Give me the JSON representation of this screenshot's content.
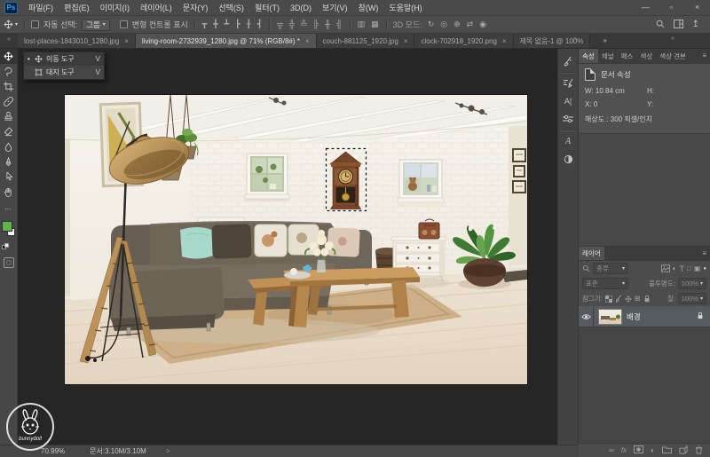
{
  "titlebar": {
    "logo": "Ps",
    "menus": [
      "파일(F)",
      "편집(E)",
      "이미지(I)",
      "레이어(L)",
      "문자(Y)",
      "선택(S)",
      "필터(T)",
      "3D(D)",
      "보기(V)",
      "창(W)",
      "도움말(H)"
    ],
    "window": {
      "minimize": "—",
      "maximize": "▫",
      "close": "×"
    }
  },
  "options_bar": {
    "auto_select_label": "자동 선택:",
    "auto_select_value": "그룹",
    "show_transform_label": "변형 컨트롤 표시",
    "mode_3d_label": "3D 모드:"
  },
  "tab_bar": {
    "tabs": [
      {
        "label": "lost-places-1843010_1280.jpg",
        "close": "×"
      },
      {
        "label": "living-room-2732939_1280.jpg @ 71% (RGB/8#) *",
        "close": "×"
      },
      {
        "label": "couch-881125_1920.jpg",
        "close": "×"
      },
      {
        "label": "clock-702918_1920.png",
        "close": "×"
      },
      {
        "label": "제목 없음-1 @ 100%",
        "close": ""
      }
    ],
    "overflow": "»"
  },
  "tool_flyout": {
    "items": [
      {
        "bullet": "•",
        "label": "이동 도구",
        "shortcut": "V"
      },
      {
        "bullet": "",
        "label": "대지 도구",
        "shortcut": "V"
      }
    ]
  },
  "panels": {
    "property_tabs": [
      "속성",
      "채널",
      "패스",
      "색상",
      "색상 견본"
    ],
    "panel_menu": "≡",
    "properties": {
      "doc_title": "문서 속성",
      "w_label": "W:",
      "w_value": "10.84 cm",
      "h_label": "H:",
      "x_label": "X:",
      "x_value": "0",
      "y_label": "Y:",
      "resolution_label": "해상도 :",
      "resolution_value": "300 픽셀/인치"
    },
    "layers": {
      "tab": "레이어",
      "filter_label": "종류",
      "blend_mode": "표준",
      "opacity_label": "불투명도:",
      "opacity_value": "100%",
      "lock_label": "잠그기:",
      "fill_label": "칠:",
      "fill_value": "100%",
      "fx_label": "fx",
      "layer_name": "배경"
    }
  },
  "status_bar": {
    "zoom": "70.99%",
    "doc_info": "문서:3.10M/3.10M",
    "expand": ">"
  },
  "watermark": {
    "text": "bunnydoll"
  },
  "colors": {
    "foreground_swatch": "#62b44a",
    "logo_blue": "#31a8ff"
  }
}
